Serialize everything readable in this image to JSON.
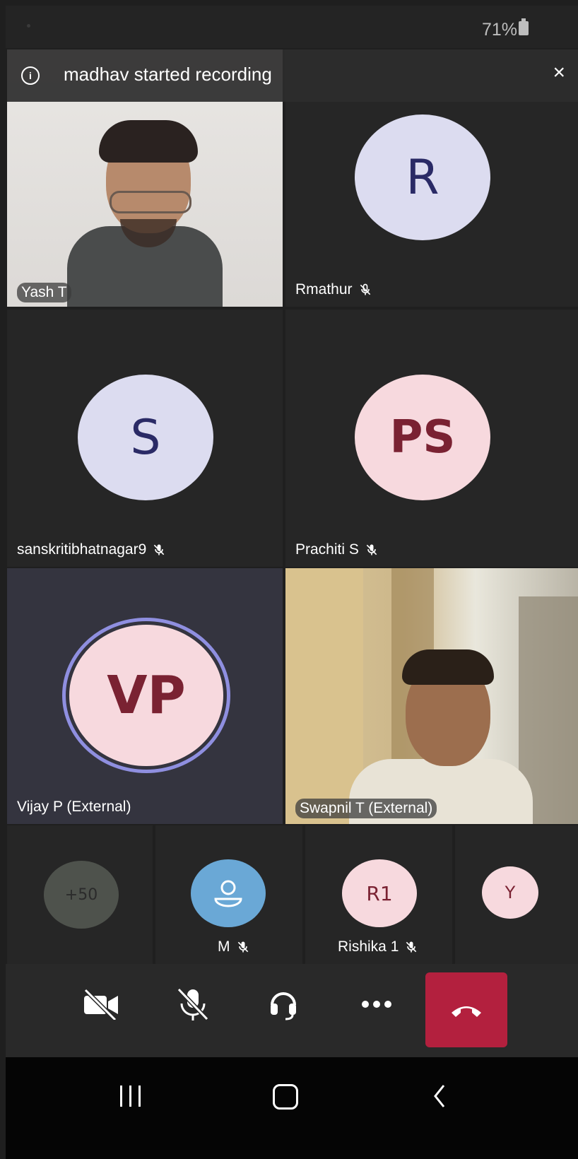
{
  "status_bar": {
    "battery": "71%"
  },
  "banner": {
    "text": "madhav started recording",
    "info_icon": "i",
    "close_icon": "×"
  },
  "tiles": {
    "yash": {
      "name": "Yash T"
    },
    "rmathur": {
      "name": "Rmathur",
      "initials": "R"
    },
    "sanskriti": {
      "name": "sanskritibhatnagar9",
      "initials": "S"
    },
    "prachiti": {
      "name": "Prachiti S",
      "initials": "PS"
    },
    "vijay": {
      "name": "Vijay P (External)",
      "initials": "VP"
    },
    "swapnil": {
      "name": "Swapnil T (External)"
    }
  },
  "strip": {
    "overflow": {
      "text": "+50"
    },
    "m": {
      "name": "M"
    },
    "rishika": {
      "name": "Rishika 1",
      "initials": "R1"
    },
    "y": {
      "initials": "Y"
    }
  },
  "toolbar": {
    "camera_icon": "camera-off-icon",
    "mic_icon": "mic-off-icon",
    "audio_icon": "headset-icon",
    "more_icon": "more-icon",
    "hangup_icon": "hang-up-icon"
  },
  "colors": {
    "hangup": "#b3203e",
    "avatar_lavender": "#dcdcf0",
    "avatar_pink": "#f7d9de",
    "active_ring": "#8f8fe0",
    "person_avatar": "#6aa8d6"
  }
}
